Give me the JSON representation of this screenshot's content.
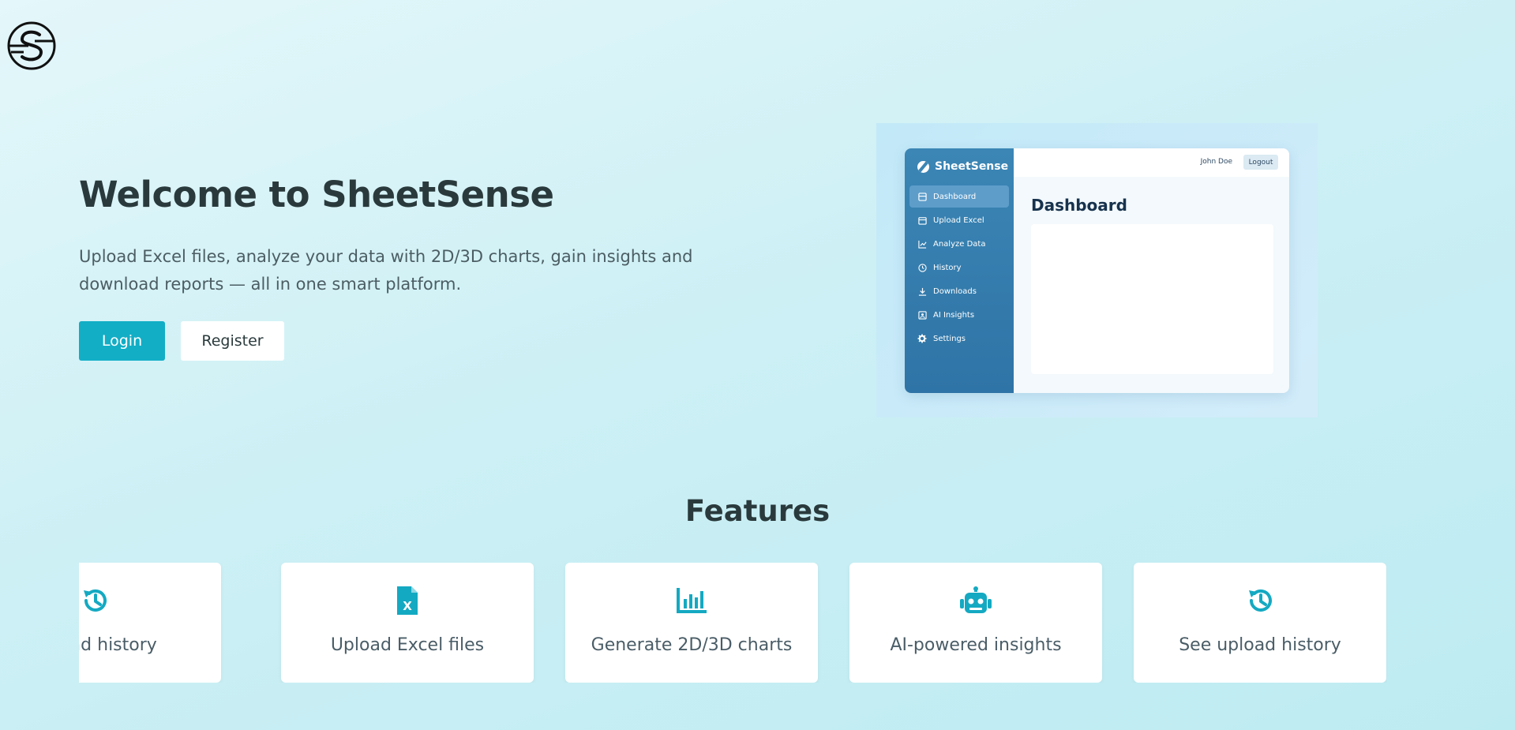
{
  "brand": {
    "logo_icon": "sheetsense-s-logo-icon"
  },
  "hero": {
    "title": "Welcome to SheetSense",
    "description": "Upload Excel files, analyze your data with 2D/3D charts, gain insights and download reports — all in one smart platform.",
    "login_label": "Login",
    "register_label": "Register"
  },
  "preview": {
    "brand": "SheetSense",
    "nav": [
      {
        "label": "Dashboard",
        "icon": "dashboard-icon",
        "active": true
      },
      {
        "label": "Upload Excel",
        "icon": "folder-icon"
      },
      {
        "label": "Analyze Data",
        "icon": "line-chart-icon"
      },
      {
        "label": "History",
        "icon": "clock-icon"
      },
      {
        "label": "Downloads",
        "icon": "download-icon"
      },
      {
        "label": "AI Insights",
        "icon": "ai-badge-icon"
      },
      {
        "label": "Settings",
        "icon": "gear-icon"
      }
    ],
    "user_name": "John Doe",
    "logout_label": "Logout",
    "heading": "Dashboard"
  },
  "features": {
    "title": "Features",
    "items": [
      {
        "label": "upload history",
        "icon": "history-icon"
      },
      {
        "label": "Upload Excel files",
        "icon": "excel-file-icon"
      },
      {
        "label": "Generate 2D/3D charts",
        "icon": "bar-chart-icon"
      },
      {
        "label": "AI-powered insights",
        "icon": "robot-icon"
      },
      {
        "label": "See upload history",
        "icon": "history-icon"
      }
    ]
  },
  "colors": {
    "accent": "#12aec6",
    "icon": "#14a9c2",
    "sidebar": "#2f74a6"
  }
}
